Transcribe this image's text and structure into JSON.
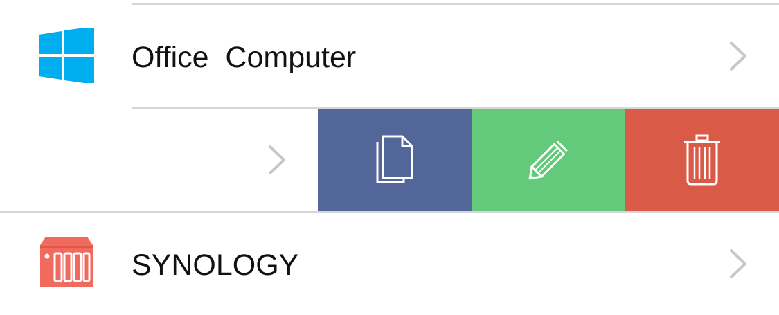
{
  "rows": [
    {
      "name": "Office  Computer",
      "icon": "windows-logo-icon",
      "accessory": "chevron-right-icon"
    },
    {
      "name": "",
      "accessory": "chevron-right-icon",
      "swipe_actions": [
        {
          "icon": "copy-icon",
          "color": "#536699"
        },
        {
          "icon": "pencil-edit-icon",
          "color": "#63c97b"
        },
        {
          "icon": "trash-icon",
          "color": "#d95b47"
        }
      ]
    },
    {
      "name": "SYNOLOGY",
      "icon": "nas-server-icon",
      "accessory": "chevron-right-icon"
    }
  ],
  "colors": {
    "windows_blue": "#00adef",
    "nas_red": "#f06a5d",
    "chevron_gray": "#c7c7cc",
    "divider": "#d6d6d9"
  }
}
